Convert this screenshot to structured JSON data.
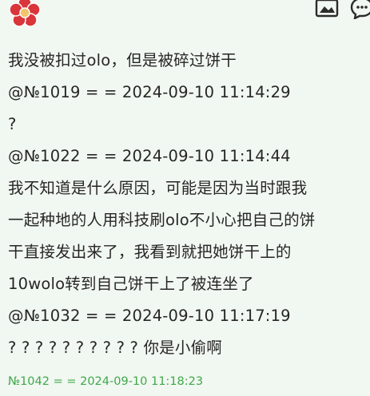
{
  "post": {
    "lines": [
      "我没被扣过olo，但是被碎过饼干",
      "@№1019 = = 2024-09-10 11:14:29",
      "?",
      "@№1022 = = 2024-09-10 11:14:44",
      "我不知道是什么原因，可能是因为当时跟我",
      "一起种地的人用科技刷olo不小心把自己的饼",
      "干直接发出来了，我看到就把她饼干上的",
      "10wolo转到自己饼干上了被连坐了",
      "@№1032 = = 2024-09-10 11:17:19",
      "? ? ? ? ? ? ? ? ? ? 你是小偷啊"
    ],
    "footer": "№1042 = = 2024-09-10 11:18:23"
  },
  "colors": {
    "background": "#f1f7f1",
    "text": "#262626",
    "footer_text": "#3fa84a",
    "avatar_red": "#d9353a"
  },
  "icons": {
    "avatar": "red-flower-avatar",
    "photo": "photo-frame-icon",
    "chat": "chat-bubble-icon"
  }
}
